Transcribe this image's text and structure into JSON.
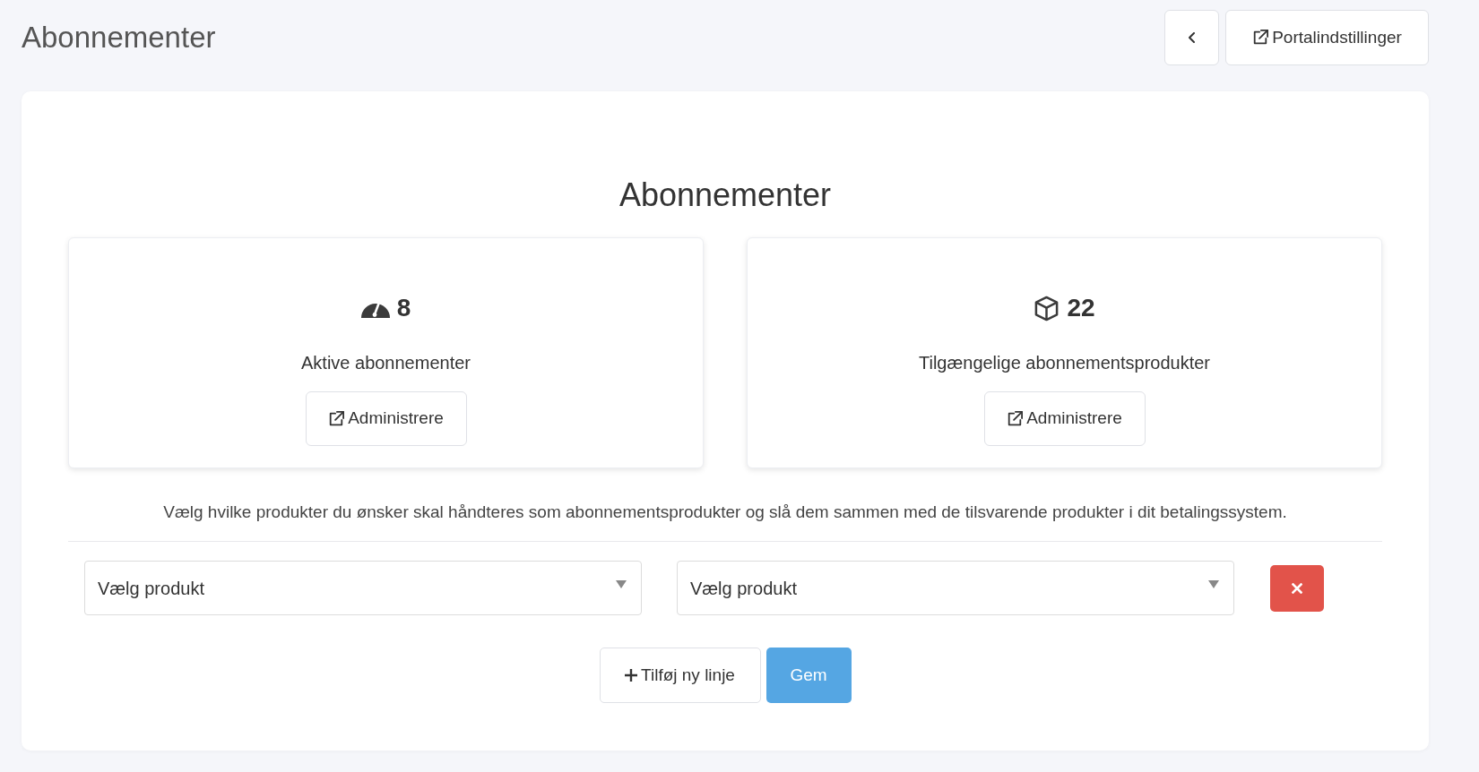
{
  "page": {
    "title": "Abonnementer"
  },
  "header_actions": [
    {
      "kind": "back"
    },
    {
      "kind": "external",
      "label": "Portalindstillinger"
    }
  ],
  "panel": {
    "heading": "Abonnementer",
    "stats": [
      {
        "kind": "gauge",
        "value": "8",
        "label": "Aktive abonnementer",
        "button": "Administrere"
      },
      {
        "kind": "box",
        "value": "22",
        "label": "Tilgængelige abonnementsprodukter",
        "button": "Administrere"
      }
    ],
    "description": "Vælg hvilke produkter du ønsker skal håndteres som abonnementsprodukter og slå dem sammen med de tilsvarende produkter i dit betalingssystem.",
    "mapping_rows": [
      {
        "product": {
          "placeholder": "Vælg produkt"
        },
        "payment_product": {
          "placeholder": "Vælg produkt"
        }
      }
    ],
    "actions": [
      {
        "kind": "add",
        "label": "Tilføj ny linje"
      },
      {
        "kind": "primary",
        "label": "Gem"
      }
    ]
  }
}
